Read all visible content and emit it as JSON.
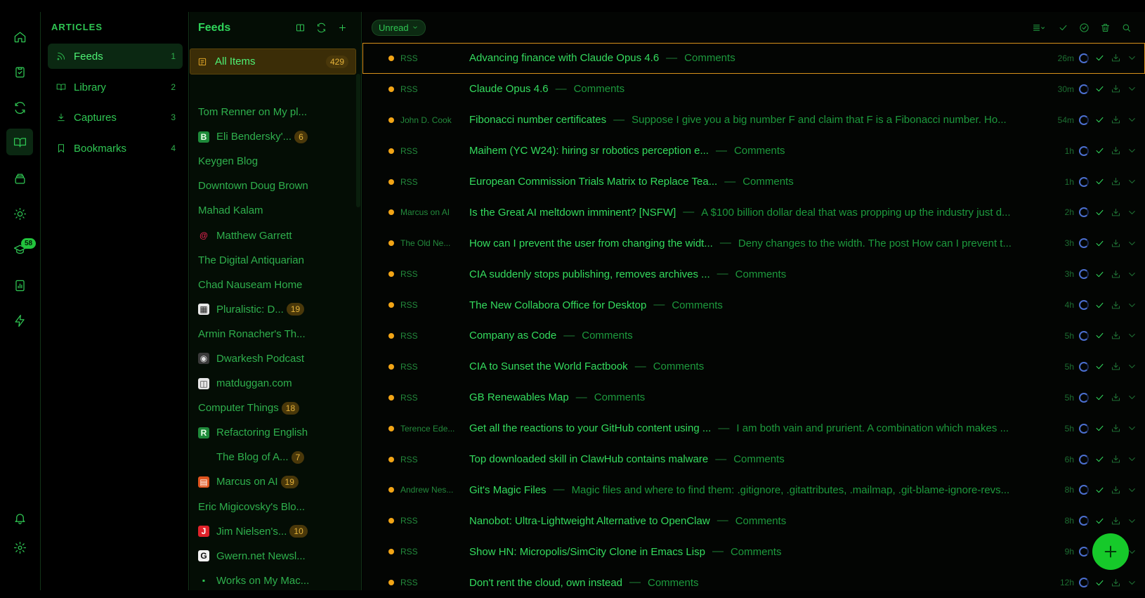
{
  "rail": {
    "badge": "58"
  },
  "sidebar": {
    "title": "ARTICLES",
    "items": [
      {
        "label": "Feeds",
        "count": "1",
        "icon": "rss-icon"
      },
      {
        "label": "Library",
        "count": "2",
        "icon": "book-icon"
      },
      {
        "label": "Captures",
        "count": "3",
        "icon": "download-icon"
      },
      {
        "label": "Bookmarks",
        "count": "4",
        "icon": "bookmark-icon"
      }
    ]
  },
  "feeds": {
    "title": "Feeds",
    "all_items": {
      "label": "All Items",
      "count": "429"
    },
    "list": [
      {
        "name": "Tom Renner on My pl...",
        "count": "",
        "icon": ""
      },
      {
        "name": "Eli Bendersky'...",
        "count": "6",
        "icon": "B"
      },
      {
        "name": "Keygen Blog",
        "count": "",
        "icon": ""
      },
      {
        "name": "Downtown Doug Brown",
        "count": "",
        "icon": ""
      },
      {
        "name": "Mahad Kalam",
        "count": "",
        "icon": ""
      },
      {
        "name": "Matthew Garrett",
        "count": "",
        "icon": "debian"
      },
      {
        "name": "The Digital Antiquarian",
        "count": "",
        "icon": ""
      },
      {
        "name": "Chad Nauseam Home",
        "count": "",
        "icon": ""
      },
      {
        "name": "Pluralistic: D...",
        "count": "19",
        "icon": "pluralistic"
      },
      {
        "name": "Armin Ronacher's Th...",
        "count": "",
        "icon": ""
      },
      {
        "name": "Dwarkesh Podcast",
        "count": "",
        "icon": "dwarkesh"
      },
      {
        "name": "matduggan.com",
        "count": "",
        "icon": "matduggan"
      },
      {
        "name": "Computer Things",
        "count": "18",
        "icon": ""
      },
      {
        "name": "Refactoring English",
        "count": "",
        "icon": "R"
      },
      {
        "name": "The Blog of A...",
        "count": "7",
        "icon": "blank"
      },
      {
        "name": "Marcus on AI",
        "count": "19",
        "icon": "marcus"
      },
      {
        "name": "Eric Migicovsky's Blo...",
        "count": "",
        "icon": ""
      },
      {
        "name": "Jim Nielsen's...",
        "count": "10",
        "icon": "jim"
      },
      {
        "name": "Gwern.net Newsl...",
        "count": "",
        "icon": "gwern"
      },
      {
        "name": "Works on My Mac...",
        "count": "",
        "icon": "works"
      }
    ]
  },
  "main": {
    "filter_label": "Unread",
    "articles": [
      {
        "source": "RSS",
        "title": "Advancing finance with Claude Opus 4.6",
        "sub": "Comments",
        "age": "26m",
        "selected": true
      },
      {
        "source": "RSS",
        "title": "Claude Opus 4.6",
        "sub": "Comments",
        "age": "30m"
      },
      {
        "source": "John D. Cook",
        "title": "Fibonacci number certificates",
        "sub": "Suppose I give you a big number F and claim that F is a Fibonacci number. Ho...",
        "age": "54m"
      },
      {
        "source": "RSS",
        "title": "Maihem (YC W24): hiring sr robotics perception e...",
        "sub": "Comments",
        "age": "1h"
      },
      {
        "source": "RSS",
        "title": "European Commission Trials Matrix to Replace Tea...",
        "sub": "Comments",
        "age": "1h"
      },
      {
        "source": "Marcus on AI",
        "title": "Is the Great AI meltdown imminent? [NSFW]",
        "sub": "A $100 billion dollar deal that was propping up the industry just d...",
        "age": "2h"
      },
      {
        "source": "The Old Ne...",
        "title": "How can I prevent the user from changing the widt...",
        "sub": "Deny changes to the width. The post How can I prevent t...",
        "age": "3h"
      },
      {
        "source": "RSS",
        "title": "CIA suddenly stops publishing, removes archives ...",
        "sub": "Comments",
        "age": "3h"
      },
      {
        "source": "RSS",
        "title": "The New Collabora Office for Desktop",
        "sub": "Comments",
        "age": "4h"
      },
      {
        "source": "RSS",
        "title": "Company as Code",
        "sub": "Comments",
        "age": "5h"
      },
      {
        "source": "RSS",
        "title": "CIA to Sunset the World Factbook",
        "sub": "Comments",
        "age": "5h"
      },
      {
        "source": "RSS",
        "title": "GB Renewables Map",
        "sub": "Comments",
        "age": "5h"
      },
      {
        "source": "Terence Ede...",
        "title": "Get all the reactions to your GitHub content using ...",
        "sub": "I am both vain and prurient. A combination which makes ...",
        "age": "5h"
      },
      {
        "source": "RSS",
        "title": "Top downloaded skill in ClawHub contains malware",
        "sub": "Comments",
        "age": "6h"
      },
      {
        "source": "Andrew Nes...",
        "title": "Git's Magic Files",
        "sub": "Magic files and where to find them: .gitignore, .gitattributes, .mailmap, .git-blame-ignore-revs...",
        "age": "8h"
      },
      {
        "source": "RSS",
        "title": "Nanobot: Ultra-Lightweight Alternative to OpenClaw",
        "sub": "Comments",
        "age": "8h"
      },
      {
        "source": "RSS",
        "title": "Show HN: Micropolis/SimCity Clone in Emacs Lisp",
        "sub": "Comments",
        "age": "9h"
      },
      {
        "source": "RSS",
        "title": "Don't rent the cloud, own instead",
        "sub": "Comments",
        "age": "12h"
      }
    ]
  },
  "colors": {
    "accent": "#2fd45a",
    "unread_dot": "#f2a516",
    "selection_border": "#d7911a",
    "fab": "#16c92a"
  }
}
